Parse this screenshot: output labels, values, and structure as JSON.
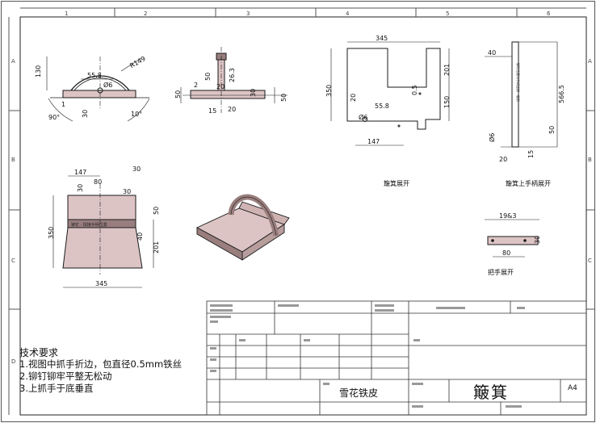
{
  "zone_columns": [
    "1",
    "2",
    "3",
    "4",
    "5",
    "6"
  ],
  "zone_rows": [
    "A",
    "B",
    "C",
    "D"
  ],
  "views": {
    "front_left": {
      "dims": [
        "130",
        "R149",
        "55.8",
        "Ø6",
        "1",
        "30",
        "90°",
        "10°"
      ]
    },
    "side": {
      "dims": [
        "50",
        "2",
        "50",
        "26.3",
        "20",
        "15",
        "20",
        "30",
        "50"
      ]
    },
    "top_view": {
      "dims": [
        "147",
        "30",
        "80",
        "30",
        "30",
        "350",
        "50",
        "40",
        "201",
        "345"
      ],
      "band_label": "铆钉 · 焊接手柄位置"
    },
    "body_unfold": {
      "dims": [
        "345",
        "350",
        "201",
        "55.8",
        "Ø6",
        "0.5",
        "150",
        "147"
      ],
      "caption": "簸箕展开"
    },
    "handle_unfold": {
      "dims": [
        "40",
        "566.5",
        "Ø6",
        "50",
        "15",
        "20"
      ],
      "band_label": "铆钉位置与手柄连接一般到",
      "caption": "簸箕上手柄展开"
    },
    "grip_unfold": {
      "dims": [
        "19&3",
        "30",
        "80"
      ],
      "caption": "把手展开"
    }
  },
  "tech_requirements": {
    "title": "技术要求",
    "items": [
      "1.视图中抓手折边，包直径0.5mm铁丝",
      "2.铆钉铆牢平整无松动",
      "3.上抓手于底垂直"
    ]
  },
  "title_block": {
    "material": "雪花铁皮",
    "part_name": "簸箕",
    "sheet_size": "A4"
  },
  "colors": {
    "part_fill": "#ddc4c4",
    "part_dark": "#9a7e7e",
    "line": "#1a1a1a",
    "dim_line": "#333333"
  }
}
